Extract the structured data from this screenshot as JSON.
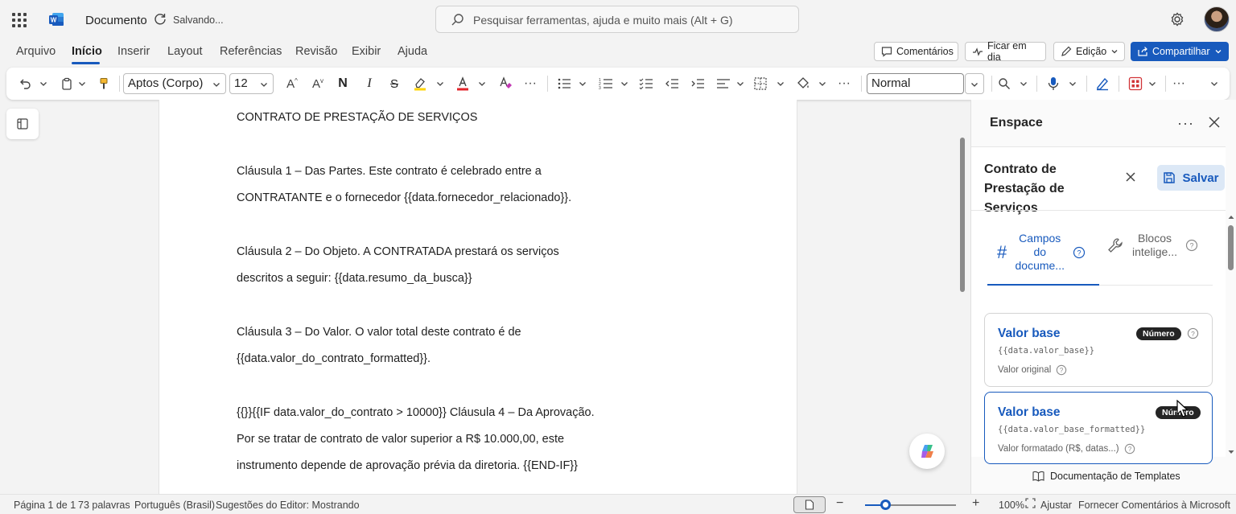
{
  "app": {
    "doc_title": "Documento",
    "status": "Salvando...",
    "search_placeholder": "Pesquisar ferramentas, ajuda e muito mais (Alt + G)"
  },
  "menu": {
    "items": [
      "Arquivo",
      "Início",
      "Inserir",
      "Layout",
      "Referências",
      "Revisão",
      "Exibir",
      "Ajuda"
    ],
    "active": "Início",
    "comments_label": "Comentários",
    "catchup_label": "Ficar em dia",
    "editing_label": "Edição",
    "share_label": "Compartilhar"
  },
  "ribbon": {
    "font_family": "Aptos (Corpo)",
    "font_size": "12",
    "style": "Normal"
  },
  "document": {
    "lines": [
      "CONTRATO DE PRESTAÇÃO DE SERVIÇOS",
      "Cláusula 1 – Das Partes. Este contrato é celebrado entre a",
      "CONTRATANTE e o fornecedor {{data.fornecedor_relacionado}}.",
      "Cláusula 2 – Do Objeto. A CONTRATADA prestará os serviços",
      "descritos a seguir: {{data.resumo_da_busca}}",
      "Cláusula 3 – Do Valor. O valor total deste contrato é de",
      "{{data.valor_do_contrato_formatted}}.",
      "{{}}{{IF data.valor_do_contrato > 10000}} Cláusula 4 – Da Aprovação.",
      "Por se tratar de contrato de valor superior a R$ 10.000,00, este",
      "instrumento depende de aprovação prévia da diretoria. {{END-IF}}"
    ]
  },
  "pane": {
    "title": "Enspace",
    "template_name": "Contrato de Prestação de Serviços",
    "save_label": "Salvar",
    "tabs": [
      {
        "label": "Campos do docume...",
        "icon": "hash-icon"
      },
      {
        "label": "Blocos intelige...",
        "icon": "wrench-icon"
      }
    ],
    "active_tab": 0,
    "cards": [
      {
        "title": "Valor base",
        "badge": "Número",
        "code": "{{data.valor_base}}",
        "description": "Valor original"
      },
      {
        "title": "Valor base",
        "badge": "Número",
        "code": "{{data.valor_base_formatted}}",
        "description": "Valor formatado (R$, datas...)"
      }
    ],
    "docs_link": "Documentação de Templates"
  },
  "statusbar": {
    "page": "Página 1 de 1",
    "words": "73 palavras",
    "language": "Português (Brasil)",
    "suggestions": "Sugestões do Editor: Mostrando",
    "zoom_percent": 100,
    "zoom": "100%",
    "fit": "Ajustar",
    "feedback": "Fornecer Comentários à Microsoft"
  },
  "colors": {
    "accent": "#185abd",
    "background": "#f3f3f3",
    "badge": "#242424"
  }
}
